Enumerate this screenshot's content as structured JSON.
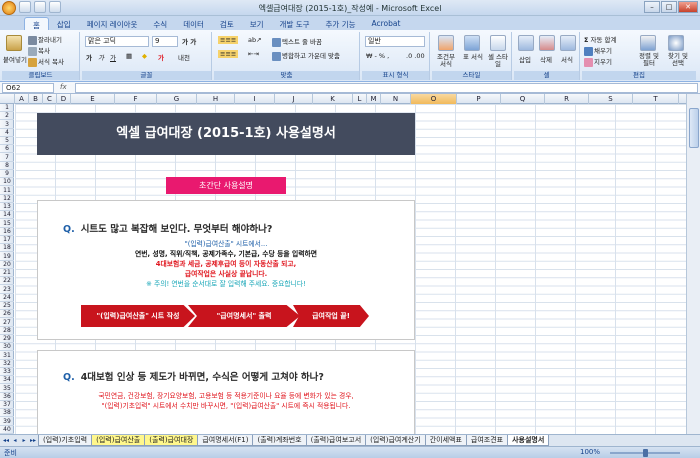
{
  "window": {
    "title": "엑셀급여대장 (2015-1호)_작성예 - Microsoft Excel",
    "min": "–",
    "max": "□",
    "close": "✕"
  },
  "tabs": [
    "홈",
    "삽입",
    "페이지 레이아웃",
    "수식",
    "데이터",
    "검토",
    "보기",
    "개발 도구",
    "추가 기능",
    "Acrobat"
  ],
  "ribbon": {
    "paste": "붙여넣기",
    "cut": "잘라내기",
    "copy": "복사",
    "format_painter": "서식 복사",
    "clipboard": "클립보드",
    "font_name": "맑은 고딕",
    "font_size": "9",
    "font_group": "글꼴",
    "wrap_text": "텍스트 줄 바꿈",
    "merge_center": "병합하고 가운데 맞춤",
    "align_group": "맞춤",
    "number_format": "일반",
    "number_group": "표시 형식",
    "conditional": "조건부 서식",
    "table_format": "표 서식",
    "cell_style": "셀 스타일",
    "style_group": "스타일",
    "insert": "삽입",
    "delete": "삭제",
    "format": "서식",
    "cells_group": "셀",
    "autosum": "자동 합계",
    "fill": "채우기",
    "clear": "지우기",
    "sort_filter": "정렬 및 필터",
    "find_select": "찾기 및 선택",
    "edit_group": "편집"
  },
  "formula_bar": {
    "name_box": "O62",
    "fx": "fx",
    "value": ""
  },
  "columns": [
    "A",
    "B",
    "C",
    "D",
    "E",
    "F",
    "G",
    "H",
    "I",
    "J",
    "K",
    "L",
    "M",
    "N",
    "O",
    "P",
    "Q",
    "R",
    "S",
    "T"
  ],
  "selected_column": "O",
  "rows": [
    "1",
    "2",
    "3",
    "4",
    "5",
    "6",
    "7",
    "8",
    "9",
    "10",
    "11",
    "12",
    "13",
    "14",
    "15",
    "16",
    "17",
    "18",
    "19",
    "20",
    "21",
    "22",
    "23",
    "24",
    "25",
    "26",
    "27",
    "28",
    "29",
    "30",
    "31",
    "32",
    "33",
    "34",
    "35",
    "36",
    "37",
    "38",
    "39",
    "40"
  ],
  "sheet": {
    "banner": "엑셀 급여대장 (2015-1호) 사용설명서",
    "quick_btn": "초간단 사용설명",
    "q1": {
      "mark": "Q.",
      "text": "시트도 많고 복잡해 보인다. 무엇부터 해야하나?"
    },
    "q1_lines": [
      {
        "text": "\"(입력)급여산출\" 시트에서...",
        "color": "#1e5fa8",
        "bold": false
      },
      {
        "text": "연번, 성명, 직위/직책, 공제가족수, 기본급, 수당 등을 입력하면",
        "color": "#111111",
        "bold": true
      },
      {
        "text": "4대보험과 세금, 공제후급여 등이 자동산출 되고,",
        "color": "#e0161e",
        "bold": true
      },
      {
        "text": "급여작업은 사실상 끝납니다.",
        "color": "#e0161e",
        "bold": true
      },
      {
        "text": "※ 주의! 연번을 순서대로 잘 입력해 주세요. 중요합니다!",
        "color": "#1aa7b8",
        "bold": false
      }
    ],
    "steps": [
      "\"(입력)급여산출\" 시트 작성",
      "\"급여명세서\" 출력",
      "급여작업 끝!"
    ],
    "q2": {
      "mark": "Q.",
      "text": "4대보험 인상 등 제도가 바뀌면, 수식은 어떻게 고쳐야 하나?"
    },
    "q2_lines": [
      {
        "text": "국민연금, 건강보험, 장기요양보험, 고용보험 등 적용기준이나 요율 등에 변화가 있는 경우,",
        "color": "#e0161e"
      },
      {
        "text": "\"(입력)기초입력\" 시트에서 수치만 바꾸시면, \"(입력)급여산출\" 시트에 즉시 적용됩니다.",
        "color": "#e0161e"
      }
    ]
  },
  "sheet_tabs": [
    {
      "label": "(입력)기초입력",
      "style": "n"
    },
    {
      "label": "(입력)급여산출",
      "style": "y"
    },
    {
      "label": "(출력)급여대장",
      "style": "y"
    },
    {
      "label": "급여명세서(F1)",
      "style": "n"
    },
    {
      "label": "(출력)계좌번호",
      "style": "n"
    },
    {
      "label": "(출력)급여보고서",
      "style": "n"
    },
    {
      "label": "(입력)급여계산기",
      "style": "n"
    },
    {
      "label": "간이세액표",
      "style": "n"
    },
    {
      "label": "급여조견표",
      "style": "n"
    },
    {
      "label": "사용설명서",
      "style": "active"
    }
  ],
  "status": {
    "ready": "준비",
    "zoom": "100%"
  },
  "colors": {
    "banner": "#434b5e",
    "pink": "#e9196f",
    "arrow_red": "#c8141d"
  }
}
